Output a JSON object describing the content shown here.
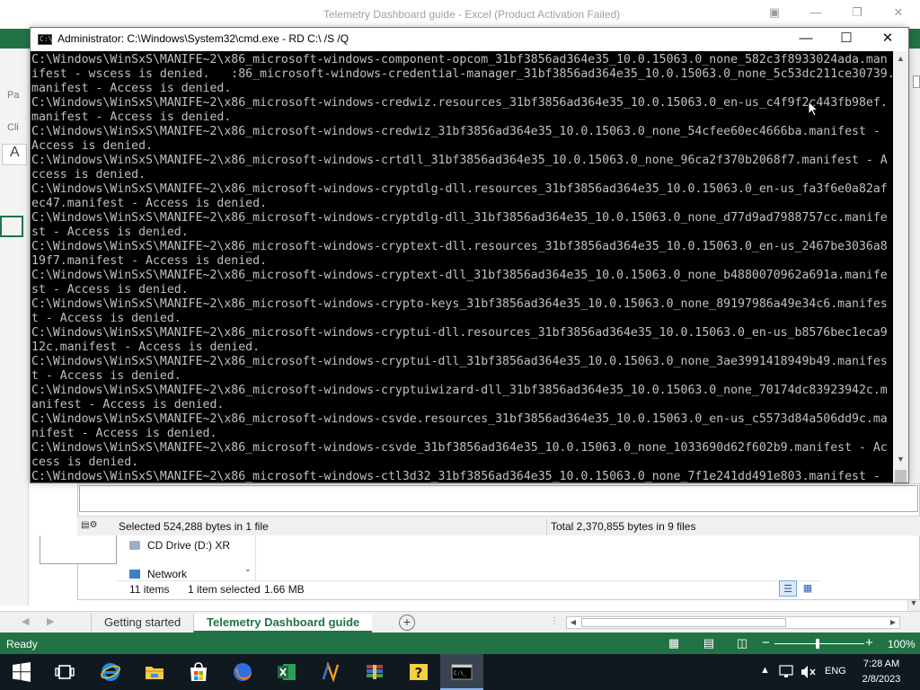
{
  "excel": {
    "title": "Telemetry Dashboard guide - Excel (Product Activation Failed)",
    "left_labels": [
      "Pa",
      "Cli"
    ],
    "namebox_text": "A",
    "sheet_tabs": [
      {
        "label": "Getting started",
        "active": false
      },
      {
        "label": "Telemetry Dashboard guide",
        "active": true
      }
    ],
    "status_ready": "Ready",
    "zoom": "100%"
  },
  "cmd": {
    "title": "Administrator: C:\\Windows\\System32\\cmd.exe - RD  C:\\ /S /Q",
    "lines": [
      "C:\\Windows\\WinSxS\\MANIFE~2\\x86_microsoft-windows-component-opcom_31bf3856ad364e35_10.0.15063.0_none_582c3f8933024ada.man",
      "ifest - wscess is denied.   :86_microsoft-windows-credential-manager_31bf3856ad364e35_10.0.15063.0_none_5c53dc211ce30739.",
      "manifest - Access is denied.",
      "C:\\Windows\\WinSxS\\MANIFE~2\\x86_microsoft-windows-credwiz.resources_31bf3856ad364e35_10.0.15063.0_en-us_c4f9f2c443fb98ef.",
      "manifest - Access is denied.",
      "C:\\Windows\\WinSxS\\MANIFE~2\\x86_microsoft-windows-credwiz_31bf3856ad364e35_10.0.15063.0_none_54cfee60ec4666ba.manifest -",
      "Access is denied.",
      "C:\\Windows\\WinSxS\\MANIFE~2\\x86_microsoft-windows-crtdll_31bf3856ad364e35_10.0.15063.0_none_96ca2f370b2068f7.manifest - A",
      "ccess is denied.",
      "C:\\Windows\\WinSxS\\MANIFE~2\\x86_microsoft-windows-cryptdlg-dll.resources_31bf3856ad364e35_10.0.15063.0_en-us_fa3f6e0a82af",
      "ec47.manifest - Access is denied.",
      "C:\\Windows\\WinSxS\\MANIFE~2\\x86_microsoft-windows-cryptdlg-dll_31bf3856ad364e35_10.0.15063.0_none_d77d9ad7988757cc.manife",
      "st - Access is denied.",
      "C:\\Windows\\WinSxS\\MANIFE~2\\x86_microsoft-windows-cryptext-dll.resources_31bf3856ad364e35_10.0.15063.0_en-us_2467be3036a8",
      "19f7.manifest - Access is denied.",
      "C:\\Windows\\WinSxS\\MANIFE~2\\x86_microsoft-windows-cryptext-dll_31bf3856ad364e35_10.0.15063.0_none_b4880070962a691a.manife",
      "st - Access is denied.",
      "C:\\Windows\\WinSxS\\MANIFE~2\\x86_microsoft-windows-crypto-keys_31bf3856ad364e35_10.0.15063.0_none_89197986a49e34c6.manifes",
      "t - Access is denied.",
      "C:\\Windows\\WinSxS\\MANIFE~2\\x86_microsoft-windows-cryptui-dll.resources_31bf3856ad364e35_10.0.15063.0_en-us_b8576bec1eca9",
      "12c.manifest - Access is denied.",
      "C:\\Windows\\WinSxS\\MANIFE~2\\x86_microsoft-windows-cryptui-dll_31bf3856ad364e35_10.0.15063.0_none_3ae3991418949b49.manifes",
      "t - Access is denied.",
      "C:\\Windows\\WinSxS\\MANIFE~2\\x86_microsoft-windows-cryptuiwizard-dll_31bf3856ad364e35_10.0.15063.0_none_70174dc83923942c.m",
      "anifest - Access is denied.",
      "C:\\Windows\\WinSxS\\MANIFE~2\\x86_microsoft-windows-csvde.resources_31bf3856ad364e35_10.0.15063.0_en-us_c5573d84a506dd9c.ma",
      "nifest - Access is denied.",
      "C:\\Windows\\WinSxS\\MANIFE~2\\x86_microsoft-windows-csvde_31bf3856ad364e35_10.0.15063.0_none_1033690d62f602b9.manifest - Ac",
      "cess is denied.",
      "C:\\Windows\\WinSxS\\MANIFE~2\\x86_microsoft-windows-ctl3d32_31bf3856ad364e35_10.0.15063.0_none_7f1e241dd491e803.manifest - "
    ]
  },
  "explorer": {
    "status_selected": "Selected 524,288 bytes in 1 file",
    "status_total": "Total 2,370,855 bytes in 9 files",
    "nav_items": [
      "CD Drive (D:) XR",
      "Network"
    ],
    "items_count": "11 items",
    "items_selected": "1 item selected",
    "selected_size": "1.66 MB"
  },
  "taskbar": {
    "language": "ENG",
    "time": "7:28 AM",
    "date": "2/8/2023",
    "apps": [
      "start-icon",
      "task-view-icon",
      "internet-explorer-icon",
      "file-explorer-icon",
      "store-icon",
      "firefox-icon",
      "excel-icon",
      "app-n-icon",
      "archive-icon",
      "help-icon",
      "cmd-icon"
    ]
  },
  "colors": {
    "excel_green": "#217346",
    "console_bg": "#000000",
    "console_fg": "#c0c0c0",
    "taskbar": "#101820"
  }
}
